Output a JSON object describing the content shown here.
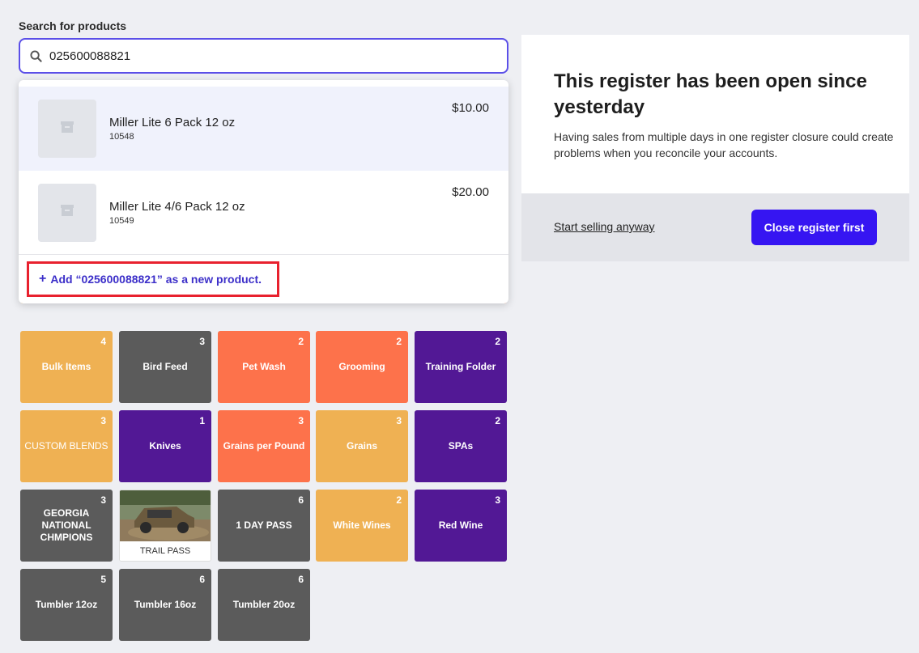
{
  "search": {
    "label": "Search for products",
    "value": "025600088821"
  },
  "results": [
    {
      "name": "Miller Lite 6 Pack 12 oz",
      "sku": "10548",
      "price": "$10.00"
    },
    {
      "name": "Miller Lite 4/6 Pack 12 oz",
      "sku": "10549",
      "price": "$20.00"
    }
  ],
  "add_new": {
    "plus": "+",
    "label": "Add “025600088821” as a new product."
  },
  "tiles": [
    {
      "label": "Bulk Items",
      "count": "4",
      "color": "#efb153"
    },
    {
      "label": "Bird Feed",
      "count": "3",
      "color": "#5b5b5b"
    },
    {
      "label": "Pet Wash",
      "count": "2",
      "color": "#fd724b"
    },
    {
      "label": "Grooming",
      "count": "2",
      "color": "#fd724b"
    },
    {
      "label": "Training Folder",
      "count": "2",
      "color": "#521895"
    },
    {
      "label": "CUSTOM BLENDS",
      "count": "3",
      "color": "#efb153"
    },
    {
      "label": "Knives",
      "count": "1",
      "color": "#521895"
    },
    {
      "label": "Grains per Pound",
      "count": "3",
      "color": "#fd724b"
    },
    {
      "label": "Grains",
      "count": "3",
      "color": "#efb153"
    },
    {
      "label": "SPAs",
      "count": "2",
      "color": "#521895"
    },
    {
      "label": "GEORGIA NATIONAL CHMPIONS",
      "count": "3",
      "color": "#5b5b5b"
    },
    {
      "label": "TRAIL PASS",
      "count": "",
      "color": "#ffffff"
    },
    {
      "label": "1 DAY PASS",
      "count": "6",
      "color": "#5b5b5b"
    },
    {
      "label": "White Wines",
      "count": "2",
      "color": "#efb153"
    },
    {
      "label": "Red Wine",
      "count": "3",
      "color": "#521895"
    },
    {
      "label": "Tumbler 12oz",
      "count": "5",
      "color": "#5b5b5b"
    },
    {
      "label": "Tumbler 16oz",
      "count": "6",
      "color": "#5b5b5b"
    },
    {
      "label": "Tumbler 20oz",
      "count": "6",
      "color": "#5b5b5b"
    }
  ],
  "panel": {
    "title": "This register has been open since yesterday",
    "description": "Having sales from multiple days in one register closure could create problems when you reconcile your accounts.",
    "secondary_action": "Start selling anyway",
    "primary_action": "Close register first",
    "primary_color": "#3615f2"
  }
}
